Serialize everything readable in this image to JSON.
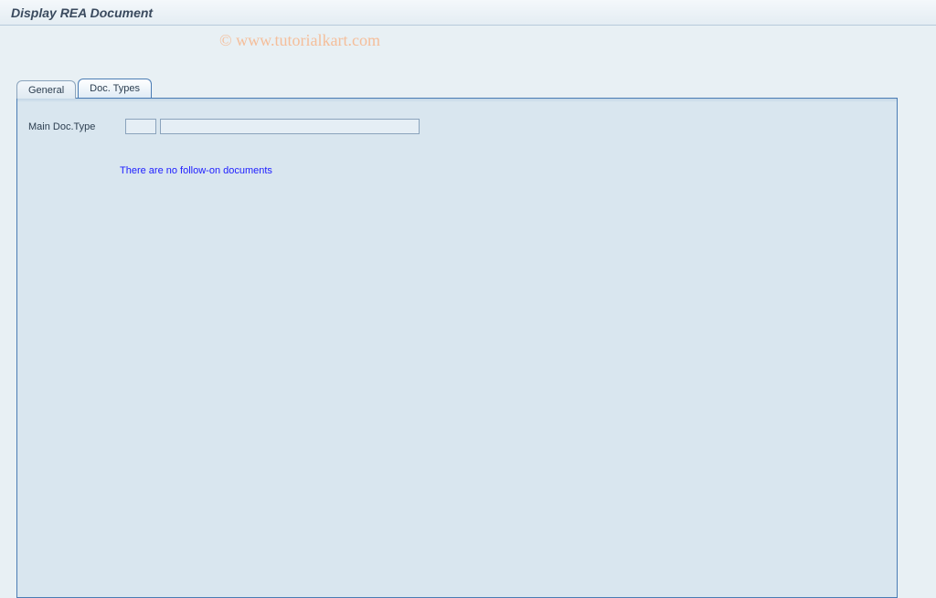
{
  "header": {
    "title": "Display REA Document"
  },
  "watermark": "© www.tutorialkart.com",
  "tabs": [
    {
      "label": "General",
      "active": false
    },
    {
      "label": "Doc. Types",
      "active": true
    }
  ],
  "panel": {
    "main_doc_type_label": "Main Doc.Type",
    "main_doc_type_code": "",
    "main_doc_type_desc": "",
    "info_message": "There are no follow-on documents"
  }
}
